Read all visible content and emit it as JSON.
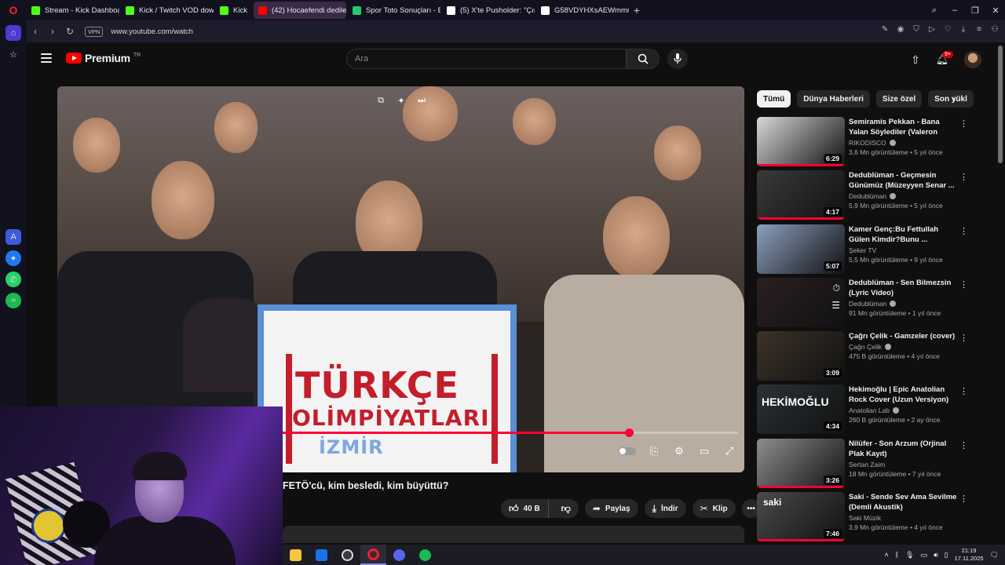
{
  "browser": {
    "tabs": [
      {
        "label": "Stream - Kick Dashboard",
        "favicon": "kick-icon",
        "color": "#53fc18",
        "active": false
      },
      {
        "label": "Kick / Twitch VOD downlo",
        "favicon": "d-icon",
        "color": "#53fc18",
        "active": false
      },
      {
        "label": "Kick",
        "favicon": "kick-icon",
        "color": "#53fc18",
        "active": false
      },
      {
        "label": "(42) Hocaefendi dediler, ...",
        "favicon": "youtube-icon",
        "color": "#ff0000",
        "active": true
      },
      {
        "label": "Spor Toto Sonuçları - Bilyo",
        "favicon": "b-icon",
        "color": "#28c76f",
        "active": false
      },
      {
        "label": "(5) X'te Pusholder: \"Çırağı",
        "favicon": "x-icon",
        "color": "#ffffff",
        "active": false
      },
      {
        "label": "G58VDYHXsAEWmmr (11",
        "favicon": "x-icon",
        "color": "#ffffff",
        "active": false
      }
    ],
    "vpn_label": "VPN",
    "url": "www.youtube.com/watch"
  },
  "youtube": {
    "logo_text": "Premium",
    "logo_country": "TR",
    "search_placeholder": "Ara",
    "notification_count": "9+",
    "video_title": "FETÖ'cü, kim besledi, kim büyüttü?",
    "player": {
      "progress": 0.76,
      "podium_line1": "TÜRKÇE",
      "podium_line2": "OLİMPİYATLARI",
      "podium_line3": "İZMİR"
    },
    "actions": {
      "like_count": "40 B",
      "share": "Paylaş",
      "download": "İndir",
      "clip": "Klip"
    },
    "chips": [
      "Tümü",
      "Dünya Haberleri",
      "Size özel",
      "Son yükl"
    ],
    "recommendations": [
      {
        "title": "Semiramis Pekkan - Bana Yalan Söylediler (Valeron Remix)",
        "channel": "RIKODISCO",
        "verified": true,
        "stats": "3,6 Mn görüntüleme • 5 yıl önce",
        "duration": "6:29",
        "watched": 1.0,
        "thumb_color": "#d8d8d8"
      },
      {
        "title": "Dedublüman - Geçmesin Günümüz (Müzeyyen Senar ...",
        "channel": "Dedublüman",
        "verified": true,
        "stats": "5,9 Mn görüntüleme • 5 yıl önce",
        "duration": "4:17",
        "watched": 1.0,
        "thumb_color": "#3a3a3a"
      },
      {
        "title": "Kamer Genç:Bu Fettullah Gülen Kimdir?Bunu ...",
        "channel": "Şeker TV",
        "verified": false,
        "stats": "5,5 Mn görüntüleme • 9 yıl önce",
        "duration": "5:07",
        "watched": 0.0,
        "thumb_color": "#8b9fbf"
      },
      {
        "title": "Dedublüman - Sen Bilmezsin (Lyric Video)",
        "channel": "Dedublüman",
        "verified": true,
        "stats": "91 Mn görüntüleme • 1 yıl önce",
        "duration": "",
        "watched": 0.0,
        "thumb_color": "#2a2020"
      },
      {
        "title": "Çağrı Çelik - Gamzeler (cover)",
        "channel": "Çağrı Çelik",
        "verified": true,
        "stats": "475 B görüntüleme • 4 yıl önce",
        "duration": "3:09",
        "watched": 0.0,
        "thumb_color": "#3c3228"
      },
      {
        "title": "Hekimoğlu | Epic Anatolian Rock Cover (Uzun Versiyon)",
        "channel": "Anatolian Lab",
        "verified": true,
        "stats": "260 B görüntüleme • 2 ay önce",
        "duration": "4:34",
        "watched": 0.0,
        "thumb_color": "#2b3236"
      },
      {
        "title": "Nilüfer - Son Arzum (Orjinal Plak Kayıt)",
        "channel": "Sertan Zaim",
        "verified": false,
        "stats": "18 Mn görüntüleme • 7 yıl önce",
        "duration": "3:26",
        "watched": 1.0,
        "thumb_color": "#8e8e8e"
      },
      {
        "title": "Saki - Sende Sev Ama Sevilme (Demli Akustik)",
        "channel": "Saki Müzik",
        "verified": false,
        "stats": "3,9 Mn görüntüleme • 4 yıl önce",
        "duration": "7:46",
        "watched": 1.0,
        "thumb_color": "#4a4a4a"
      }
    ],
    "thumb_overlays": {
      "hekimoglu": "HEKİMOĞLU",
      "saki": "saki"
    }
  },
  "taskbar": {
    "time": "21:19",
    "date": "17.11.2025"
  },
  "colors": {
    "accent_red": "#ff0033",
    "opera_red": "#ff1b2d",
    "opera_home": "#4b3ccf"
  }
}
